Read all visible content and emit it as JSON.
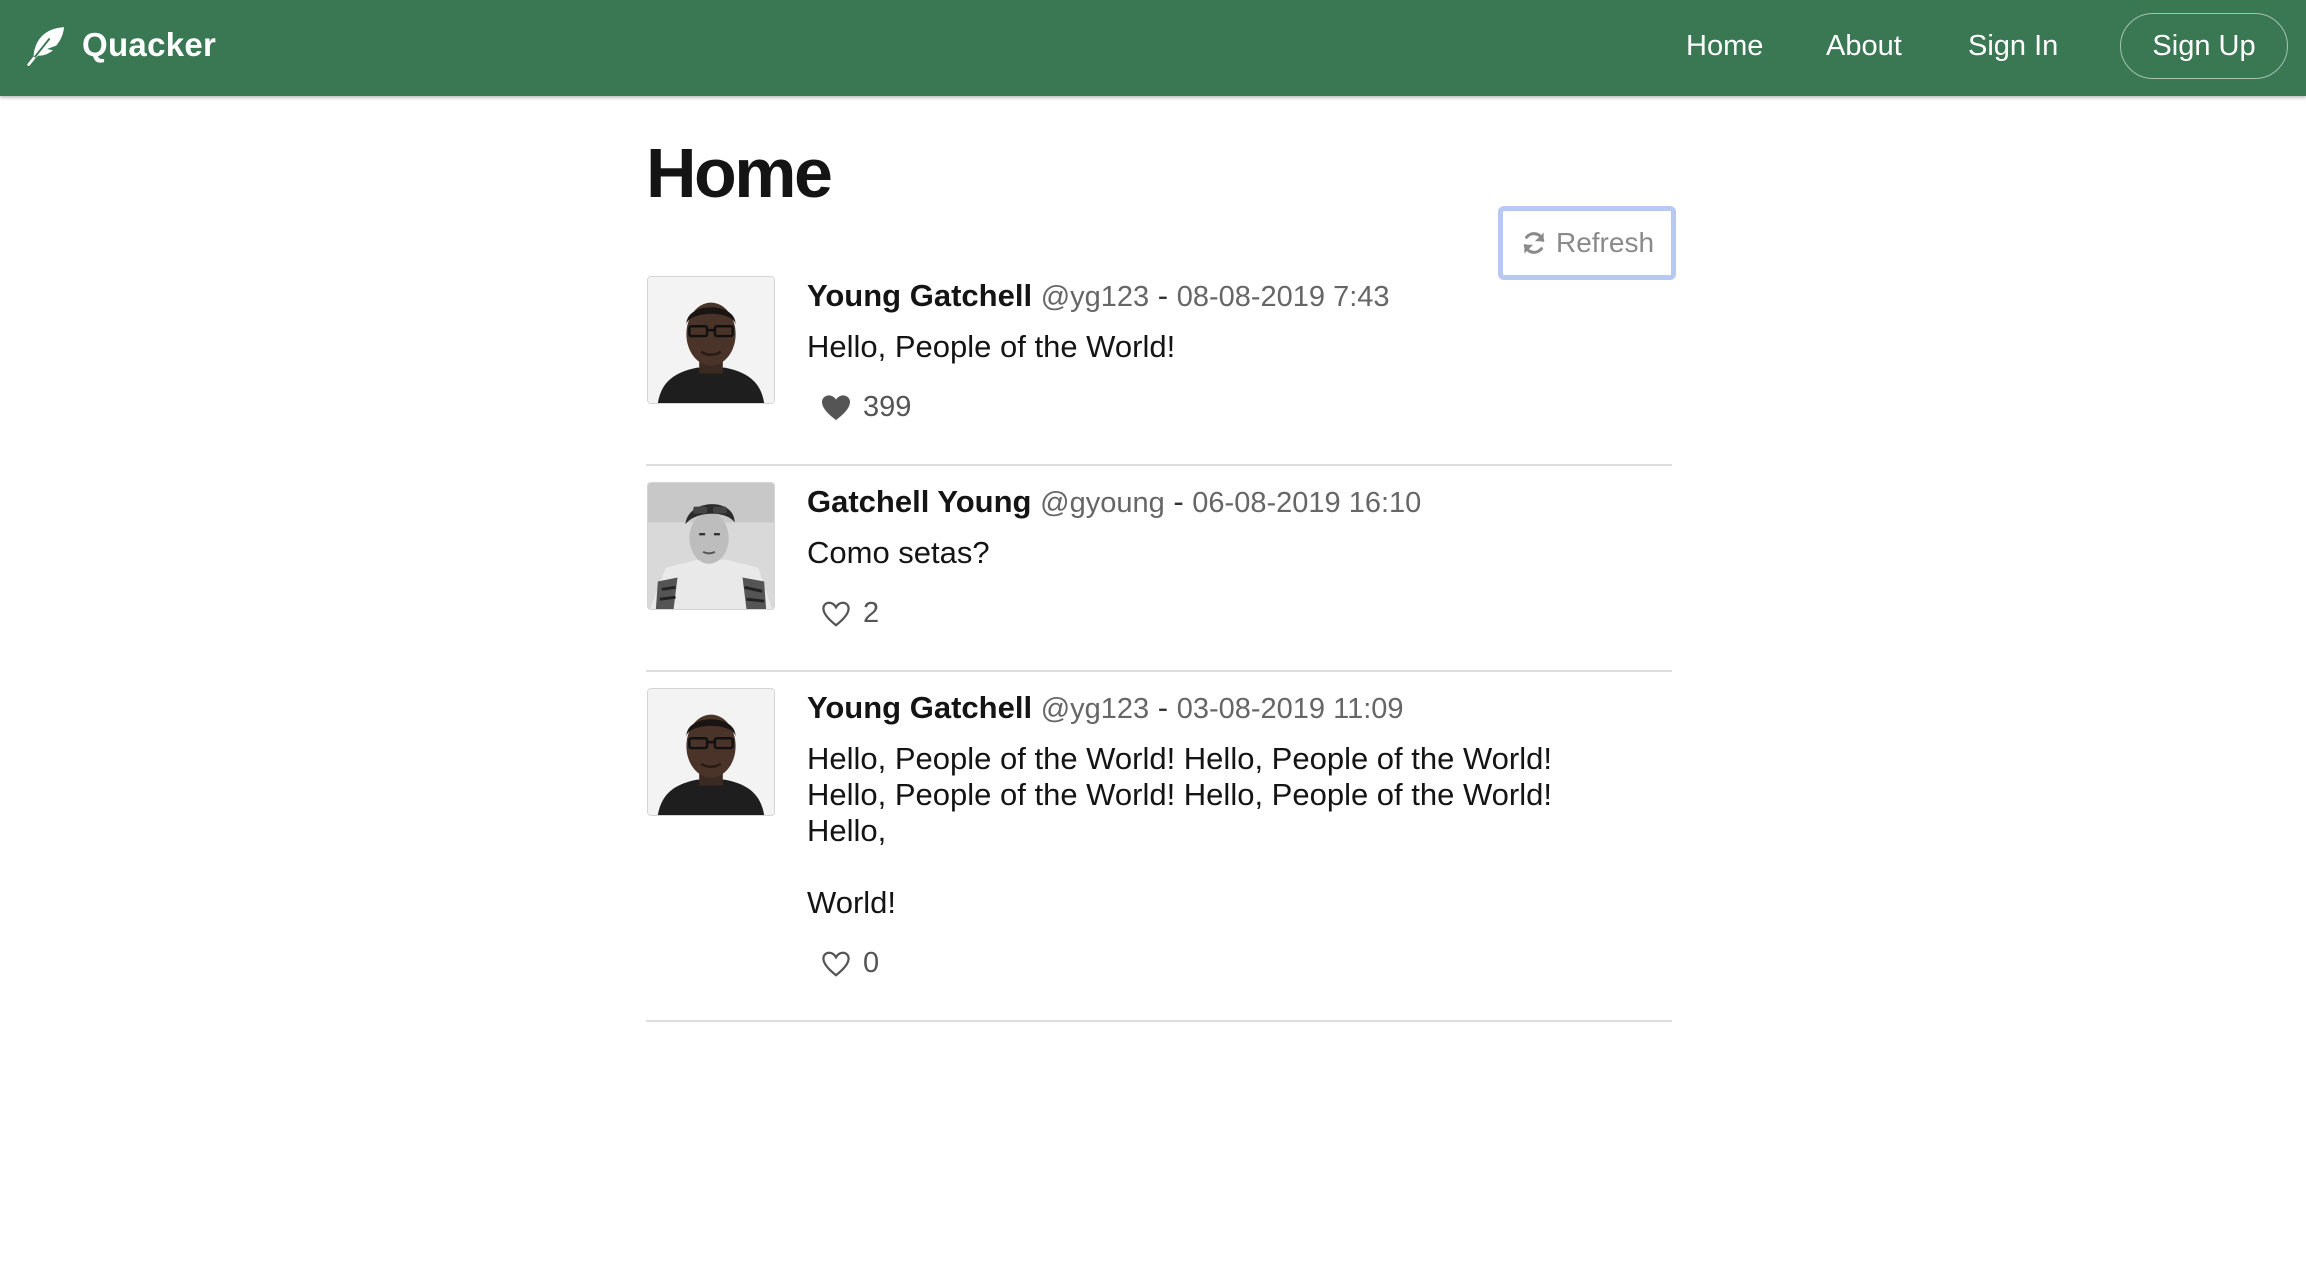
{
  "navbar": {
    "brand": "Quacker",
    "brand_icon": "feather-icon",
    "color": "#3a7854",
    "links": {
      "home": "Home",
      "about": "About",
      "sign_in": "Sign In"
    },
    "sign_up": "Sign Up"
  },
  "page": {
    "title": "Home",
    "refresh_label": "Refresh",
    "refresh_icon": "refresh-icon"
  },
  "tweets": [
    {
      "name": "Young Gatchell",
      "handle": "@yg123",
      "separator": "-",
      "date": "08-08-2019 7:43",
      "text": "Hello, People of the World!",
      "likes": "399",
      "liked": true,
      "like_icon": "heart-filled-icon"
    },
    {
      "name": "Gatchell Young",
      "handle": "@gyoung",
      "separator": "-",
      "date": "06-08-2019 16:10",
      "text": "Como setas?",
      "likes": "2",
      "liked": false,
      "like_icon": "heart-outline-icon"
    },
    {
      "name": "Young Gatchell",
      "handle": "@yg123",
      "separator": "-",
      "date": "03-08-2019 11:09",
      "text": "Hello, People of the World! Hello, People of the World!\nHello, People of the World! Hello, People of the World!\nHello,\n\nWorld!",
      "likes": "0",
      "liked": false,
      "like_icon": "heart-outline-icon"
    }
  ]
}
